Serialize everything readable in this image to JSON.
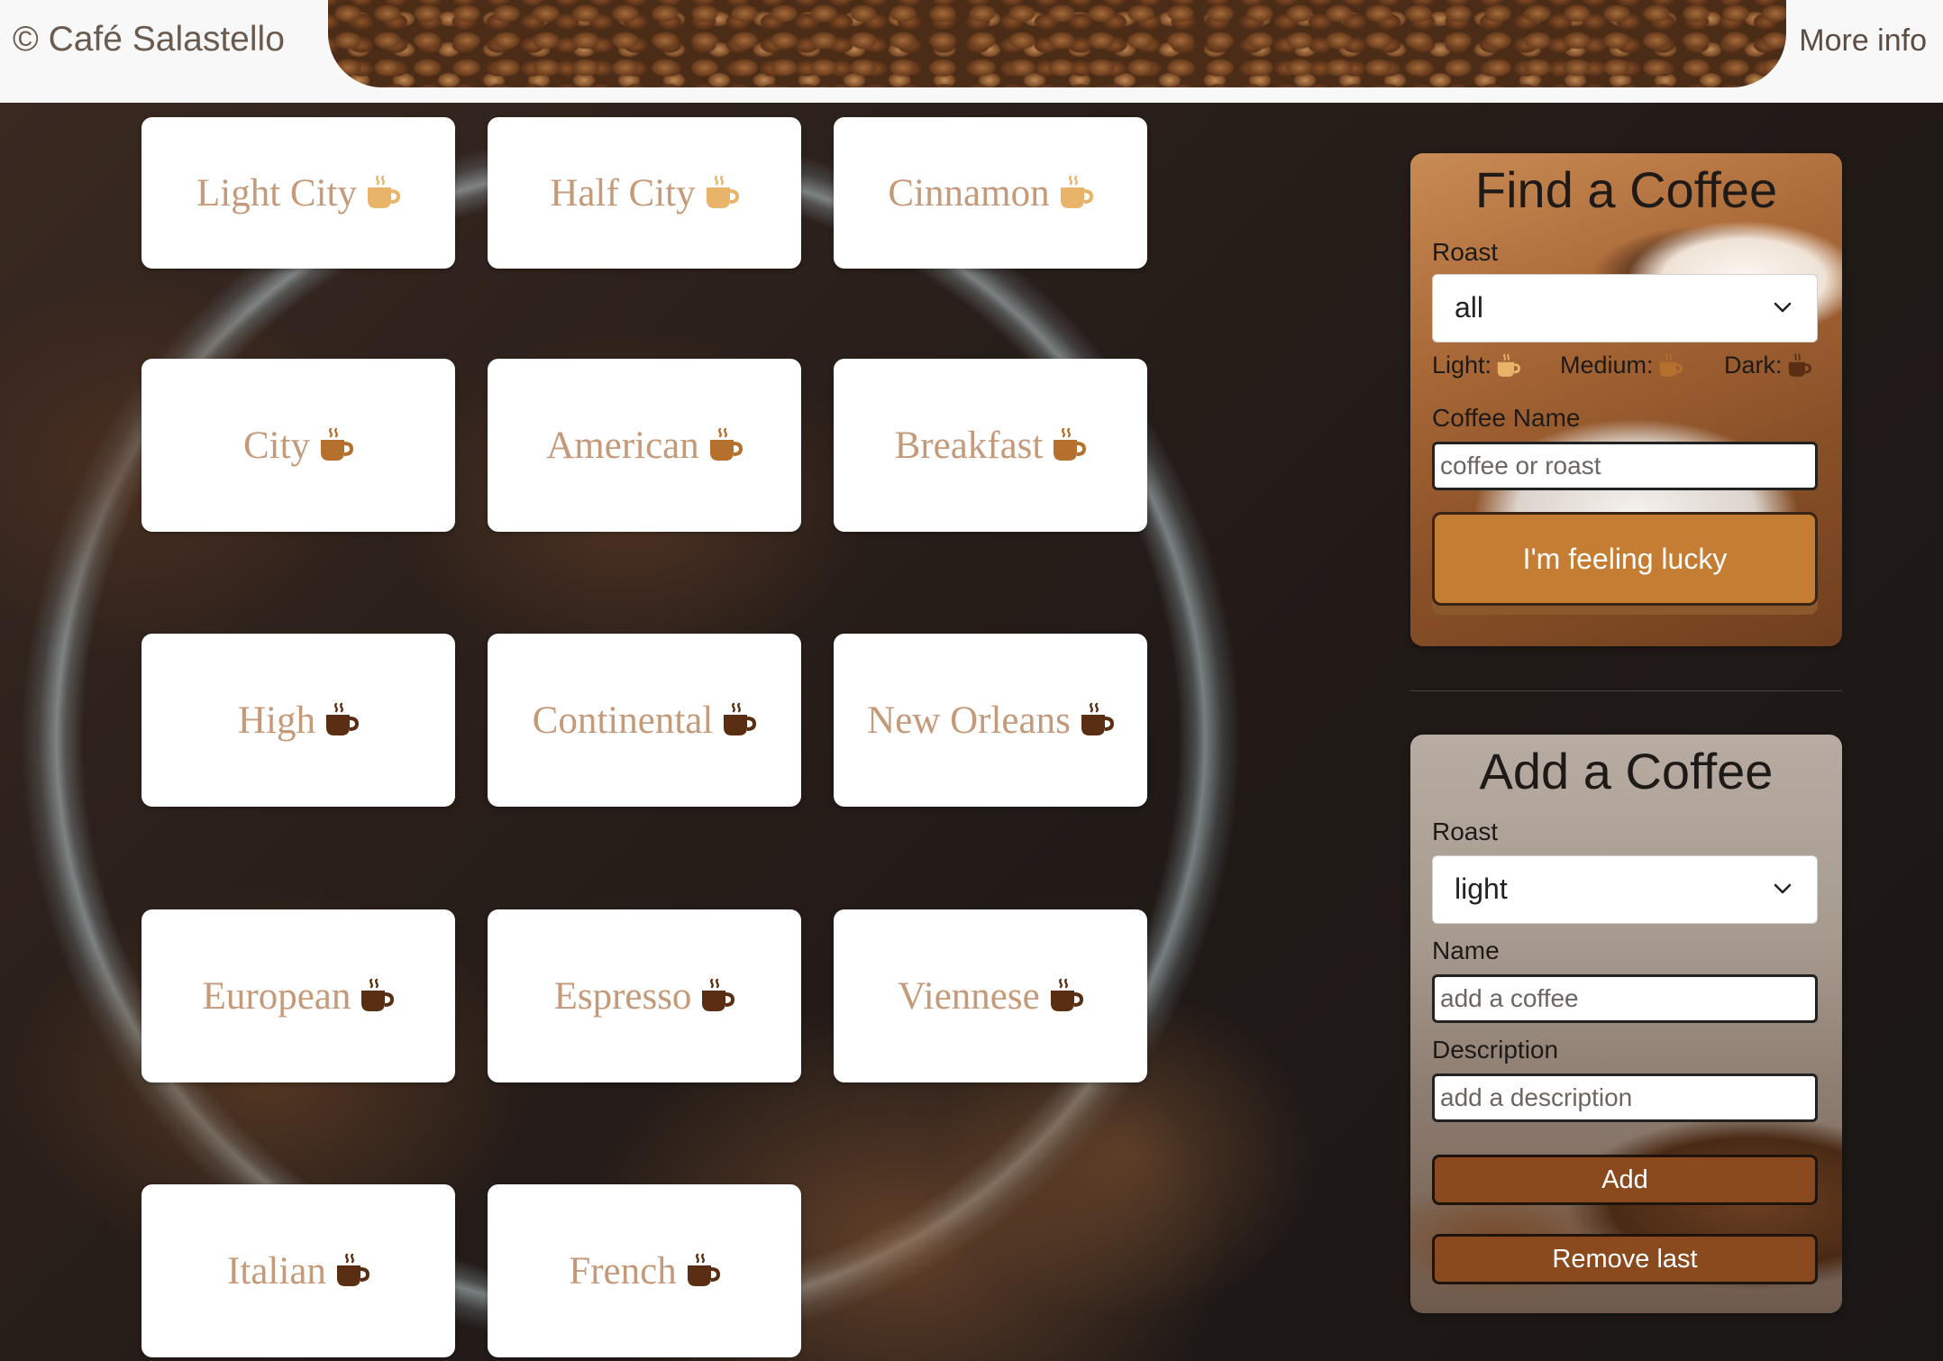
{
  "header": {
    "brand": "© Café Salastello",
    "more_info": "More info"
  },
  "coffees": [
    {
      "name": "Light City",
      "roast": "light"
    },
    {
      "name": "Half City",
      "roast": "light"
    },
    {
      "name": "Cinnamon",
      "roast": "light"
    },
    {
      "name": "City",
      "roast": "medium"
    },
    {
      "name": "American",
      "roast": "medium"
    },
    {
      "name": "Breakfast",
      "roast": "medium"
    },
    {
      "name": "High",
      "roast": "dark"
    },
    {
      "name": "Continental",
      "roast": "dark"
    },
    {
      "name": "New Orleans",
      "roast": "dark"
    },
    {
      "name": "European",
      "roast": "dark"
    },
    {
      "name": "Espresso",
      "roast": "dark"
    },
    {
      "name": "Viennese",
      "roast": "dark"
    },
    {
      "name": "Italian",
      "roast": "dark"
    },
    {
      "name": "French",
      "roast": "dark"
    }
  ],
  "find": {
    "title": "Find a Coffee",
    "roast_label": "Roast",
    "roast_value": "all",
    "legend": {
      "light": "Light:",
      "medium": "Medium:",
      "dark": "Dark:"
    },
    "name_label": "Coffee Name",
    "name_placeholder": "coffee or roast",
    "lucky_button": "I'm feeling lucky"
  },
  "add": {
    "title": "Add a Coffee",
    "roast_label": "Roast",
    "roast_value": "light",
    "name_label": "Name",
    "name_placeholder": "add a coffee",
    "description_label": "Description",
    "description_placeholder": "add a description",
    "add_button": "Add",
    "remove_button": "Remove last"
  },
  "colors": {
    "light_cup": "#e8b46a",
    "medium_cup": "#b5702d",
    "dark_cup": "#5a2e12",
    "card_text": "#c59a7a",
    "accent": "#c47d33"
  },
  "icons": {
    "cup": "coffee-cup-icon",
    "chevron": "chevron-down-icon"
  }
}
